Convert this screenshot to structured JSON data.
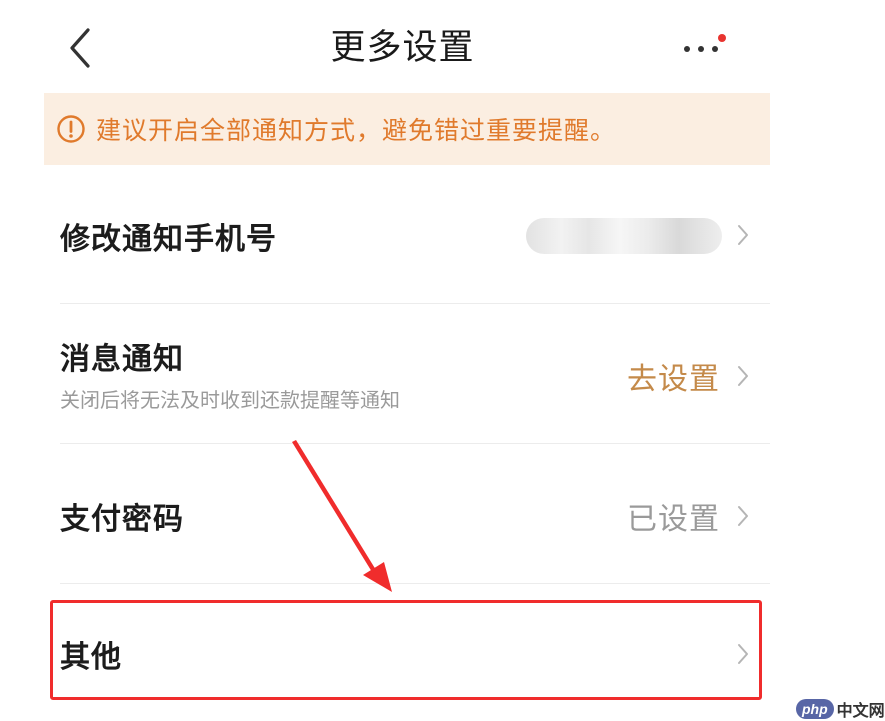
{
  "header": {
    "title": "更多设置",
    "back_icon": "chevron-left-icon",
    "more_icon": "more-horizontal-icon",
    "has_unread_dot": true
  },
  "notice": {
    "icon": "warning-circle-icon",
    "text": "建议开启全部通知方式，避免错过重要提醒。",
    "color": "#e07a2c",
    "background": "#fbeee1"
  },
  "settings": [
    {
      "title": "修改通知手机号",
      "value_obscured": true
    },
    {
      "title": "消息通知",
      "subtitle": "关闭后将无法及时收到还款提醒等通知",
      "value": "去设置",
      "value_color": "#c48a4a"
    },
    {
      "title": "支付密码",
      "value": "已设置",
      "value_color": "#9a9a9a"
    },
    {
      "title": "其他",
      "highlighted": true
    }
  ],
  "annotation": {
    "highlight_color": "#f02c2c"
  },
  "watermark": {
    "logo": "php",
    "text": "中文网"
  }
}
